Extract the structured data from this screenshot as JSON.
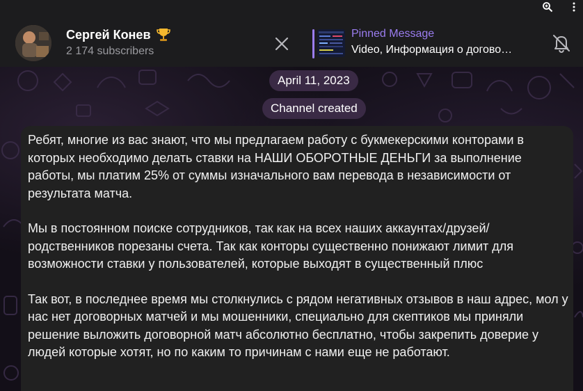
{
  "header": {
    "channel_name": "Сергей Конев",
    "subscribers": "2 174 subscribers",
    "pinned": {
      "title": "Pinned Message",
      "preview": "Video, Информация о догово…"
    }
  },
  "chat": {
    "date_badge": "April 11, 2023",
    "service_message": "Channel created",
    "message": {
      "paragraphs": [
        "Ребят, многие из вас знают, что мы предлагаем работу с букмекерскими конторами в которых необходимо делать ставки на НАШИ ОБОРОТНЫЕ ДЕНЬГИ за выполнение работы, мы платим 25% от суммы изначального вам перевода в независимости от результата матча.",
        "Мы в постоянном поиске сотрудников, так как на всех наших аккаунтах/друзей/родственников порезаны счета. Так как конторы существенно понижают лимит для возможности ставки у пользователей, которые выходят в существенный плюс",
        "Так вот, в  последнее время мы столкнулись с рядом негативных отзывов в наш адрес, мол у нас нет договорных матчей и мы мошенники, специально для скептиков мы приняли решение выложить договорной матч абсолютно бесплатно, чтобы закрепить доверие у людей которые хотят, но по каким то причинам с нами еще не работают."
      ]
    }
  },
  "colors": {
    "accent": "#9b7df0",
    "header_bg": "#1c1c1e",
    "bubble_bg": "#212121",
    "pill_bg": "#3a2a45",
    "secondary_text": "#9a9a9f"
  },
  "icons": [
    "zoom-icon",
    "more-icon",
    "trophy-icon",
    "close-icon",
    "mute-bell-icon"
  ]
}
